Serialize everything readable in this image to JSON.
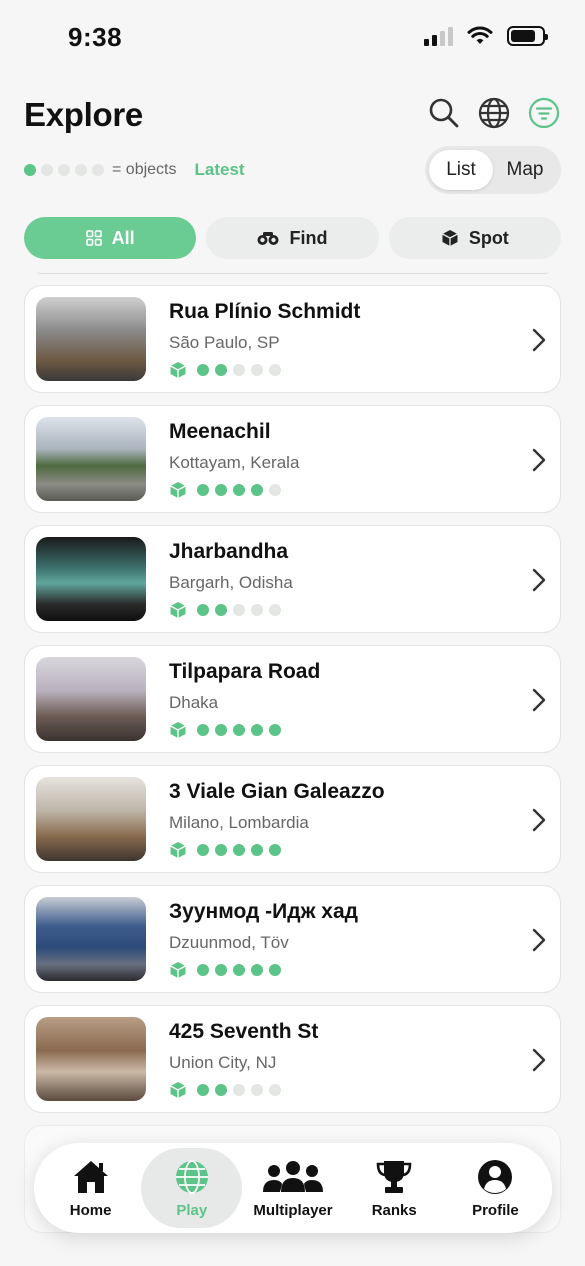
{
  "status_bar": {
    "time": "9:38"
  },
  "header": {
    "title": "Explore",
    "legend_text": "= objects",
    "latest_label": "Latest",
    "view_toggle": {
      "list_label": "List",
      "map_label": "Map",
      "active": "List"
    }
  },
  "filters": [
    {
      "label": "All",
      "icon": "grid-icon",
      "active": true
    },
    {
      "label": "Find",
      "icon": "binoculars-icon",
      "active": false
    },
    {
      "label": "Spot",
      "icon": "cube-icon",
      "active": false
    }
  ],
  "colors": {
    "accent": "#5cc389",
    "chip_active": "#6acb93"
  },
  "places": [
    {
      "title": "Rua Plínio Schmidt",
      "subtitle": "São Paulo, SP",
      "objects": 2
    },
    {
      "title": "Meenachil",
      "subtitle": "Kottayam, Kerala",
      "objects": 4
    },
    {
      "title": "Jharbandha",
      "subtitle": "Bargarh, Odisha",
      "objects": 2
    },
    {
      "title": "Tilpapara Road",
      "subtitle": "Dhaka",
      "objects": 5
    },
    {
      "title": "3 Viale Gian Galeazzo",
      "subtitle": "Milano, Lombardia",
      "objects": 5
    },
    {
      "title": "Зуунмод -Идж хад",
      "subtitle": "Dzuunmod, Töv",
      "objects": 5
    },
    {
      "title": "425 Seventh St",
      "subtitle": "Union City, NJ",
      "objects": 2
    }
  ],
  "tabs": [
    {
      "label": "Home",
      "icon": "home-icon",
      "active": false
    },
    {
      "label": "Play",
      "icon": "globe-icon",
      "active": true
    },
    {
      "label": "Multiplayer",
      "icon": "people-icon",
      "active": false
    },
    {
      "label": "Ranks",
      "icon": "trophy-icon",
      "active": false
    },
    {
      "label": "Profile",
      "icon": "profile-icon",
      "active": false
    }
  ]
}
